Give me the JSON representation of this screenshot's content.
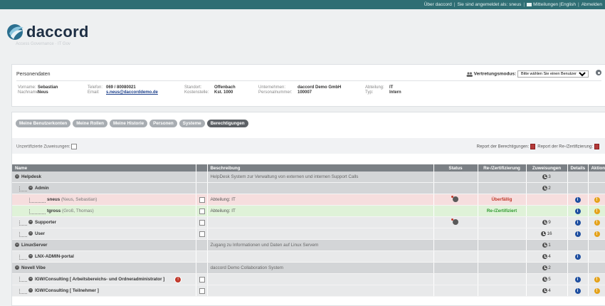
{
  "topbar": {
    "about": "Über daccord",
    "logged_in_as": "Sie sind angemeldet als: sneus",
    "messages": "Mitteilungen",
    "english": "|English",
    "logout": "Abmelden"
  },
  "logo": {
    "brand": "daccord",
    "tagline": "Access Governance · IT Gov"
  },
  "person": {
    "section_title": "Personendaten",
    "vorname_label": "Vorname:",
    "vorname": "Sebastian",
    "nachname_label": "Nachname:",
    "nachname": "Neus",
    "telefon_label": "Telefon:",
    "telefon": "069 / 80080021",
    "email_label": "Email:",
    "email": "s.neus@daccorddemo.de",
    "standort_label": "Standort:",
    "standort": "Offenbach",
    "kostenstelle_label": "Kostenstelle:",
    "kostenstelle": "Kst. 1000",
    "unternehmen_label": "Unternehmen:",
    "unternehmen": "daccord Demo GmbH",
    "personalnummer_label": "Personalnummer:",
    "personalnummer": "100007",
    "abteilung_label": "Abteilung:",
    "abteilung": "IT",
    "typ_label": "Typ:",
    "typ": "Intern",
    "vertretung_label": "Vertretungsmodus:",
    "vertretung_placeholder": "Bitte wählen Sie einen Benutzer"
  },
  "tabs": [
    "Meine Benutzerkonten",
    "Meine Rollen",
    "Meine Historie",
    "Personen",
    "Systeme",
    "Berechtigungen"
  ],
  "filter": {
    "unzertifiziert_label": "Unzertifizierte Zuweisungen:",
    "report_berechtigungen": "Report der Berechtigungen:",
    "report_rezert": "Report der Re-/Zertifizierung:"
  },
  "table": {
    "headers": [
      "Name",
      "",
      "Beschreibung",
      "Status",
      "Re-/Zertifizierung",
      "Zuweisungen",
      "Details",
      "Aktionen"
    ],
    "rows": {
      "r0": {
        "name": "Helpdesk",
        "desc": "HelpDesk System zur Verwaltung von externen und internen Support Calls",
        "count": "3"
      },
      "r1": {
        "name": "Admin",
        "count": "2"
      },
      "r2": {
        "name": "sneus",
        "sub": "(Neus, Sebastian)",
        "desc": "Abteilung: IT",
        "recert": "Überfällig"
      },
      "r3": {
        "name": "tgross",
        "sub": "(Groß, Thomas)",
        "desc": "Abteilung: IT",
        "recert": "Re-/Zertifiziert"
      },
      "r4": {
        "name": "Supporter",
        "count": "9"
      },
      "r5": {
        "name": "User",
        "count": "16"
      },
      "r6": {
        "name": "LinuxServer",
        "desc": "Zugang zu Informationen und Daten auf Linux Servern",
        "count": "1"
      },
      "r7": {
        "name": "LNX-ADMIN-portal",
        "count": "4"
      },
      "r8": {
        "name": "Novell Vibe",
        "desc": "daccord Demo Collaboration System",
        "count": "2"
      },
      "r9": {
        "name": "IGW/Consulting [ Arbeitsbereichs- und Ordneradministrator ]",
        "count": "5"
      },
      "r10": {
        "name": "IGW/Consulting [ Teilnehmer ]",
        "count": "4"
      }
    }
  }
}
